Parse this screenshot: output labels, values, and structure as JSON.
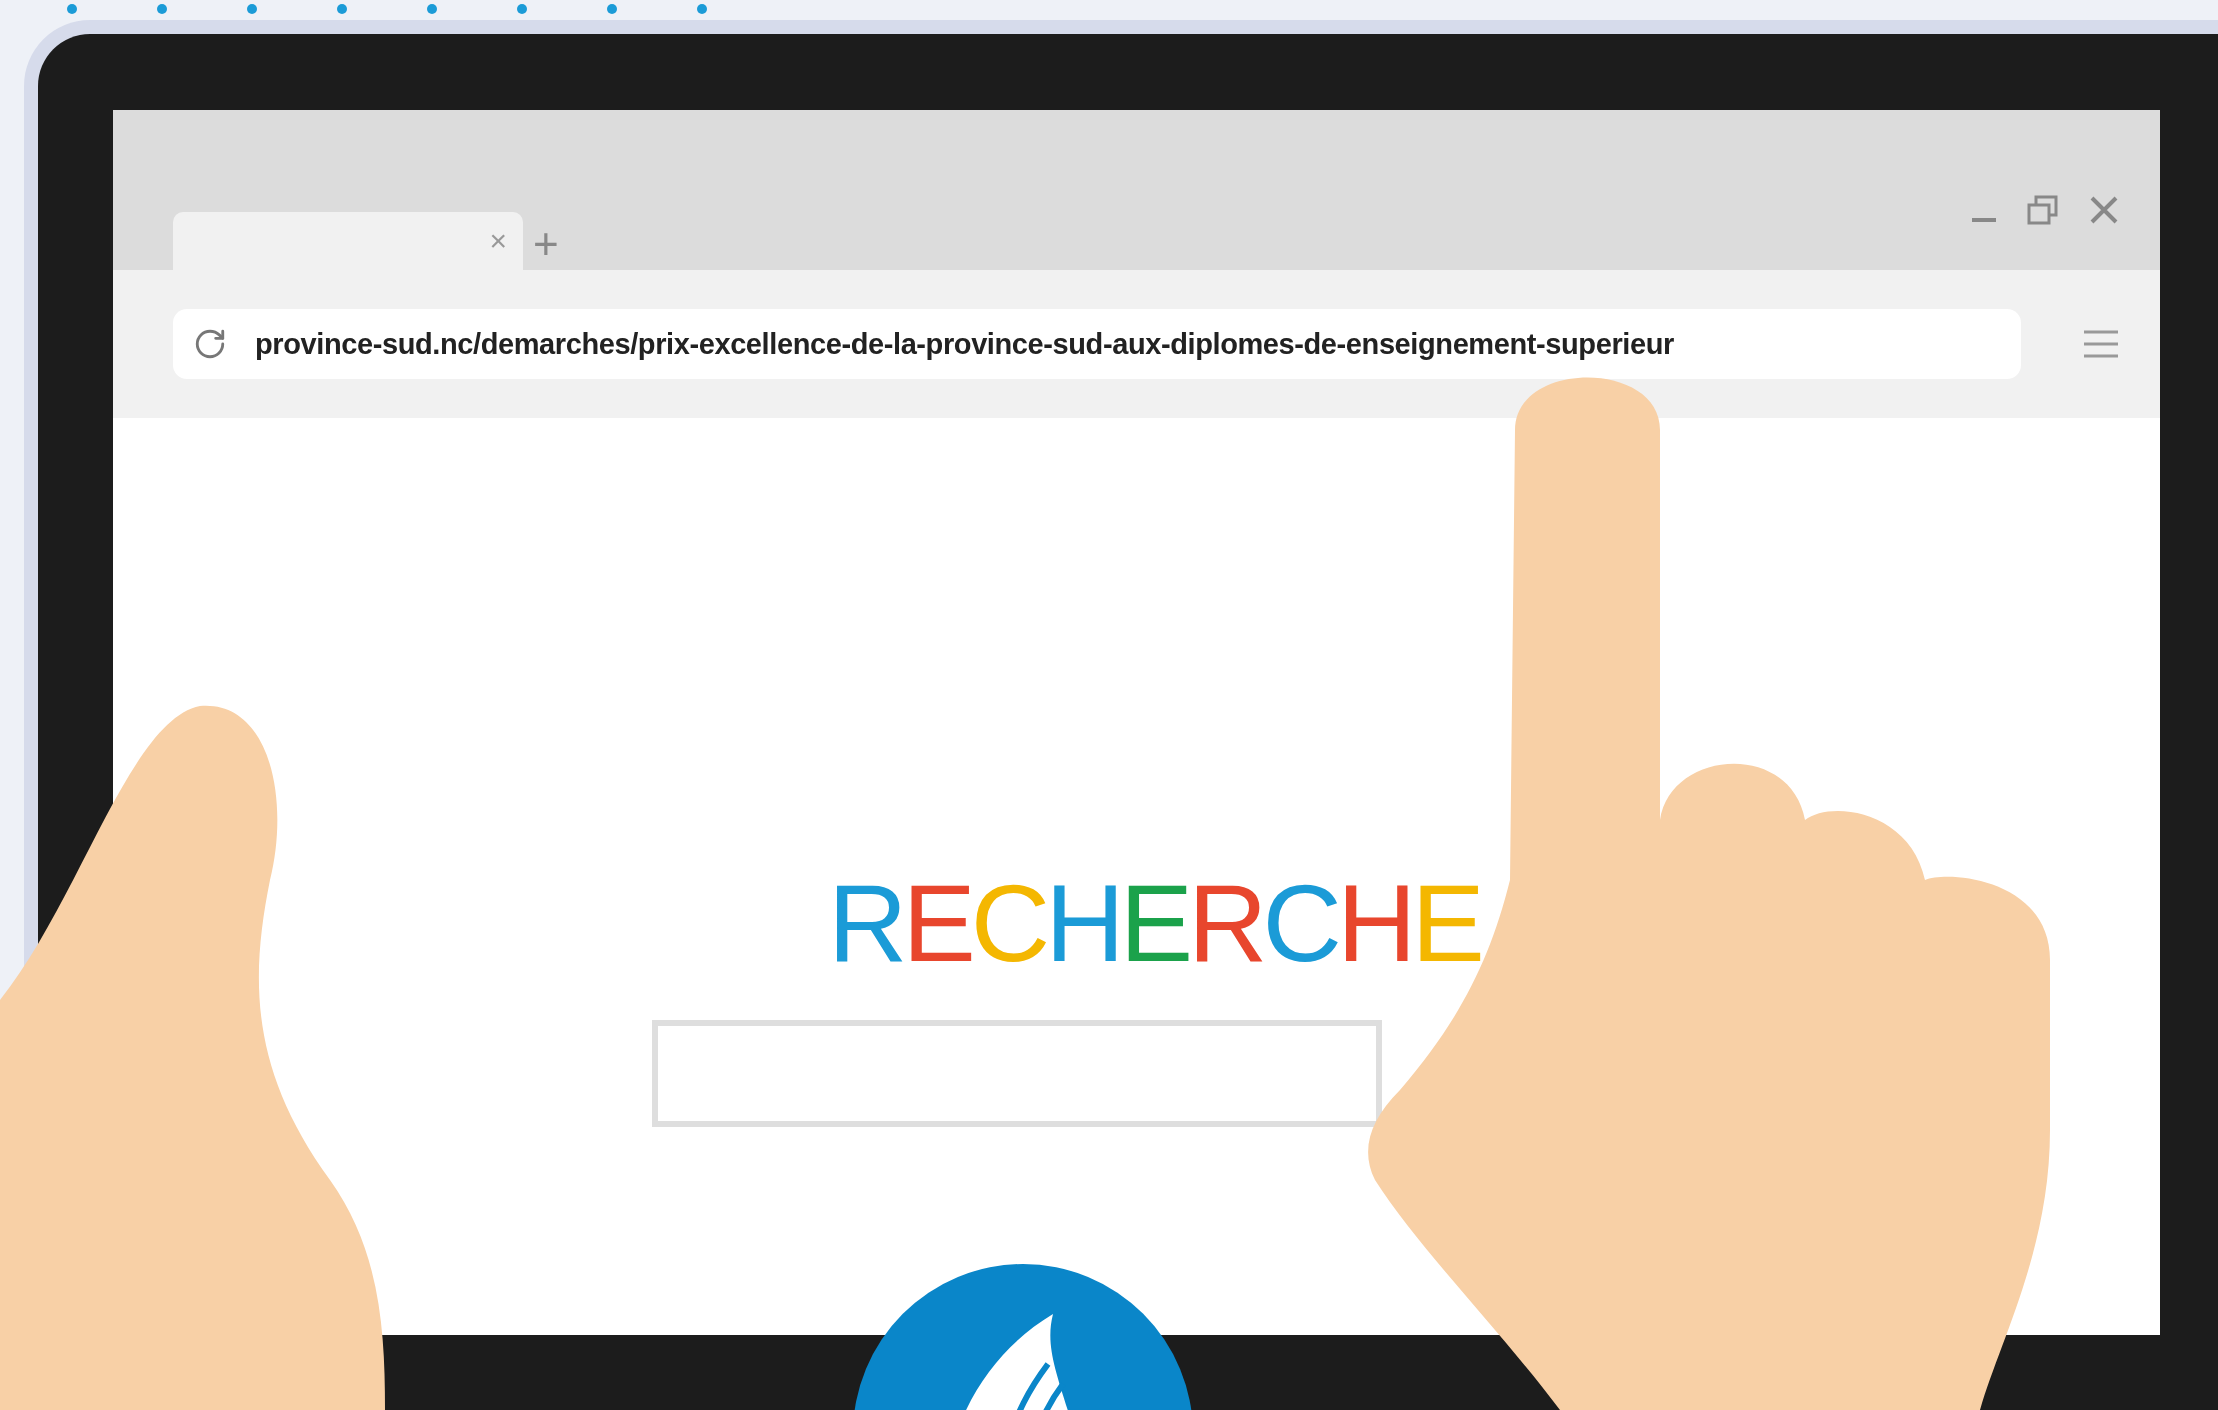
{
  "browser": {
    "tab": {
      "close": "×",
      "selected": true
    },
    "new_tab": "+",
    "address": "province-sud.nc/demarches/prix-excellence-de-la-province-sud-aux-diplomes-de-enseignement-superieur",
    "heading": [
      {
        "letter": "R",
        "color": "#1b9bd7"
      },
      {
        "letter": "E",
        "color": "#e8462d"
      },
      {
        "letter": "C",
        "color": "#f4b701"
      },
      {
        "letter": "H",
        "color": "#1b9bd7"
      },
      {
        "letter": "E",
        "color": "#1ba24b"
      },
      {
        "letter": "R",
        "color": "#e8462d"
      },
      {
        "letter": "C",
        "color": "#1b9bd7"
      },
      {
        "letter": "H",
        "color": "#e8462d"
      },
      {
        "letter": "E",
        "color": "#f4b701"
      }
    ]
  }
}
